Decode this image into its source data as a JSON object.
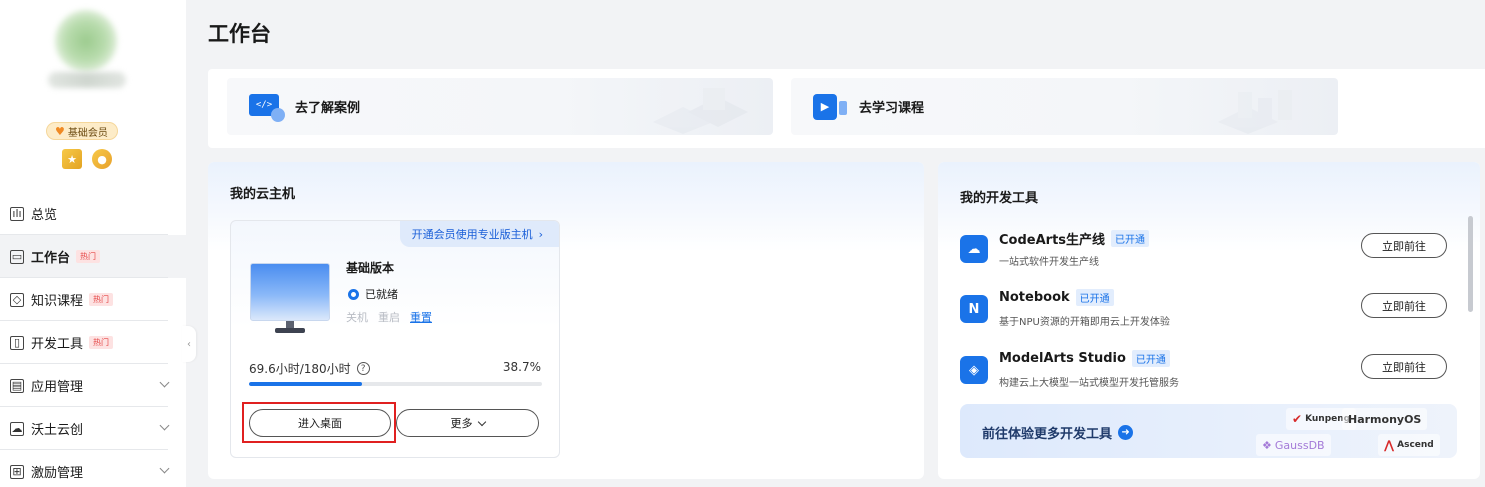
{
  "sidebar": {
    "member_badge": "基础会员",
    "items": [
      {
        "label": "总览",
        "icon": "chart-icon",
        "hot": "",
        "expandable": false,
        "active": false
      },
      {
        "label": "工作台",
        "icon": "monitor-icon",
        "hot": "热门",
        "expandable": false,
        "active": true
      },
      {
        "label": "知识课程",
        "icon": "cube-icon",
        "hot": "热门",
        "expandable": false,
        "active": false
      },
      {
        "label": "开发工具",
        "icon": "tool-icon",
        "hot": "热门",
        "expandable": false,
        "active": false
      },
      {
        "label": "应用管理",
        "icon": "app-icon",
        "hot": "",
        "expandable": true,
        "active": false
      },
      {
        "label": "沃土云创",
        "icon": "cloud-icon",
        "hot": "",
        "expandable": true,
        "active": false
      },
      {
        "label": "激励管理",
        "icon": "gift-icon",
        "hot": "",
        "expandable": true,
        "active": false
      }
    ]
  },
  "page": {
    "title": "工作台"
  },
  "quick_links": [
    {
      "label": "去了解案例",
      "icon": "code-screen-icon"
    },
    {
      "label": "去学习课程",
      "icon": "video-play-icon"
    }
  ],
  "cloud_host": {
    "title": "我的云主机",
    "upgrade_link": "开通会员使用专业版主机",
    "plan_name": "基础版本",
    "status": "已就绪",
    "actions": {
      "shutdown": "关机",
      "restart": "重启",
      "reset": "重置"
    },
    "usage_text": "69.6小时/180小时",
    "usage_percent_text": "38.7%",
    "usage_fraction": 0.387,
    "enter_button": "进入桌面",
    "more_button": "更多"
  },
  "dev_tools": {
    "title": "我的开发工具",
    "tools": [
      {
        "name": "CodeArts生产线",
        "badge": "已开通",
        "desc": "一站式软件开发生产线",
        "button": "立即前往"
      },
      {
        "name": "Notebook",
        "badge": "已开通",
        "desc": "基于NPU资源的开箱即用云上开发体验",
        "button": "立即前往"
      },
      {
        "name": "ModelArts Studio",
        "badge": "已开通",
        "desc": "构建云上大模型一站式模型开发托管服务",
        "button": "立即前往"
      }
    ],
    "more_banner": "前往体验更多开发工具",
    "partner_logos": [
      "Kunpeng",
      "HarmonyOS",
      "GaussDB",
      "Ascend"
    ]
  },
  "colors": {
    "accent": "#1a73e8",
    "hot_bg": "#fde2e2",
    "hot_text": "#e54545",
    "highlight": "#e02020"
  }
}
